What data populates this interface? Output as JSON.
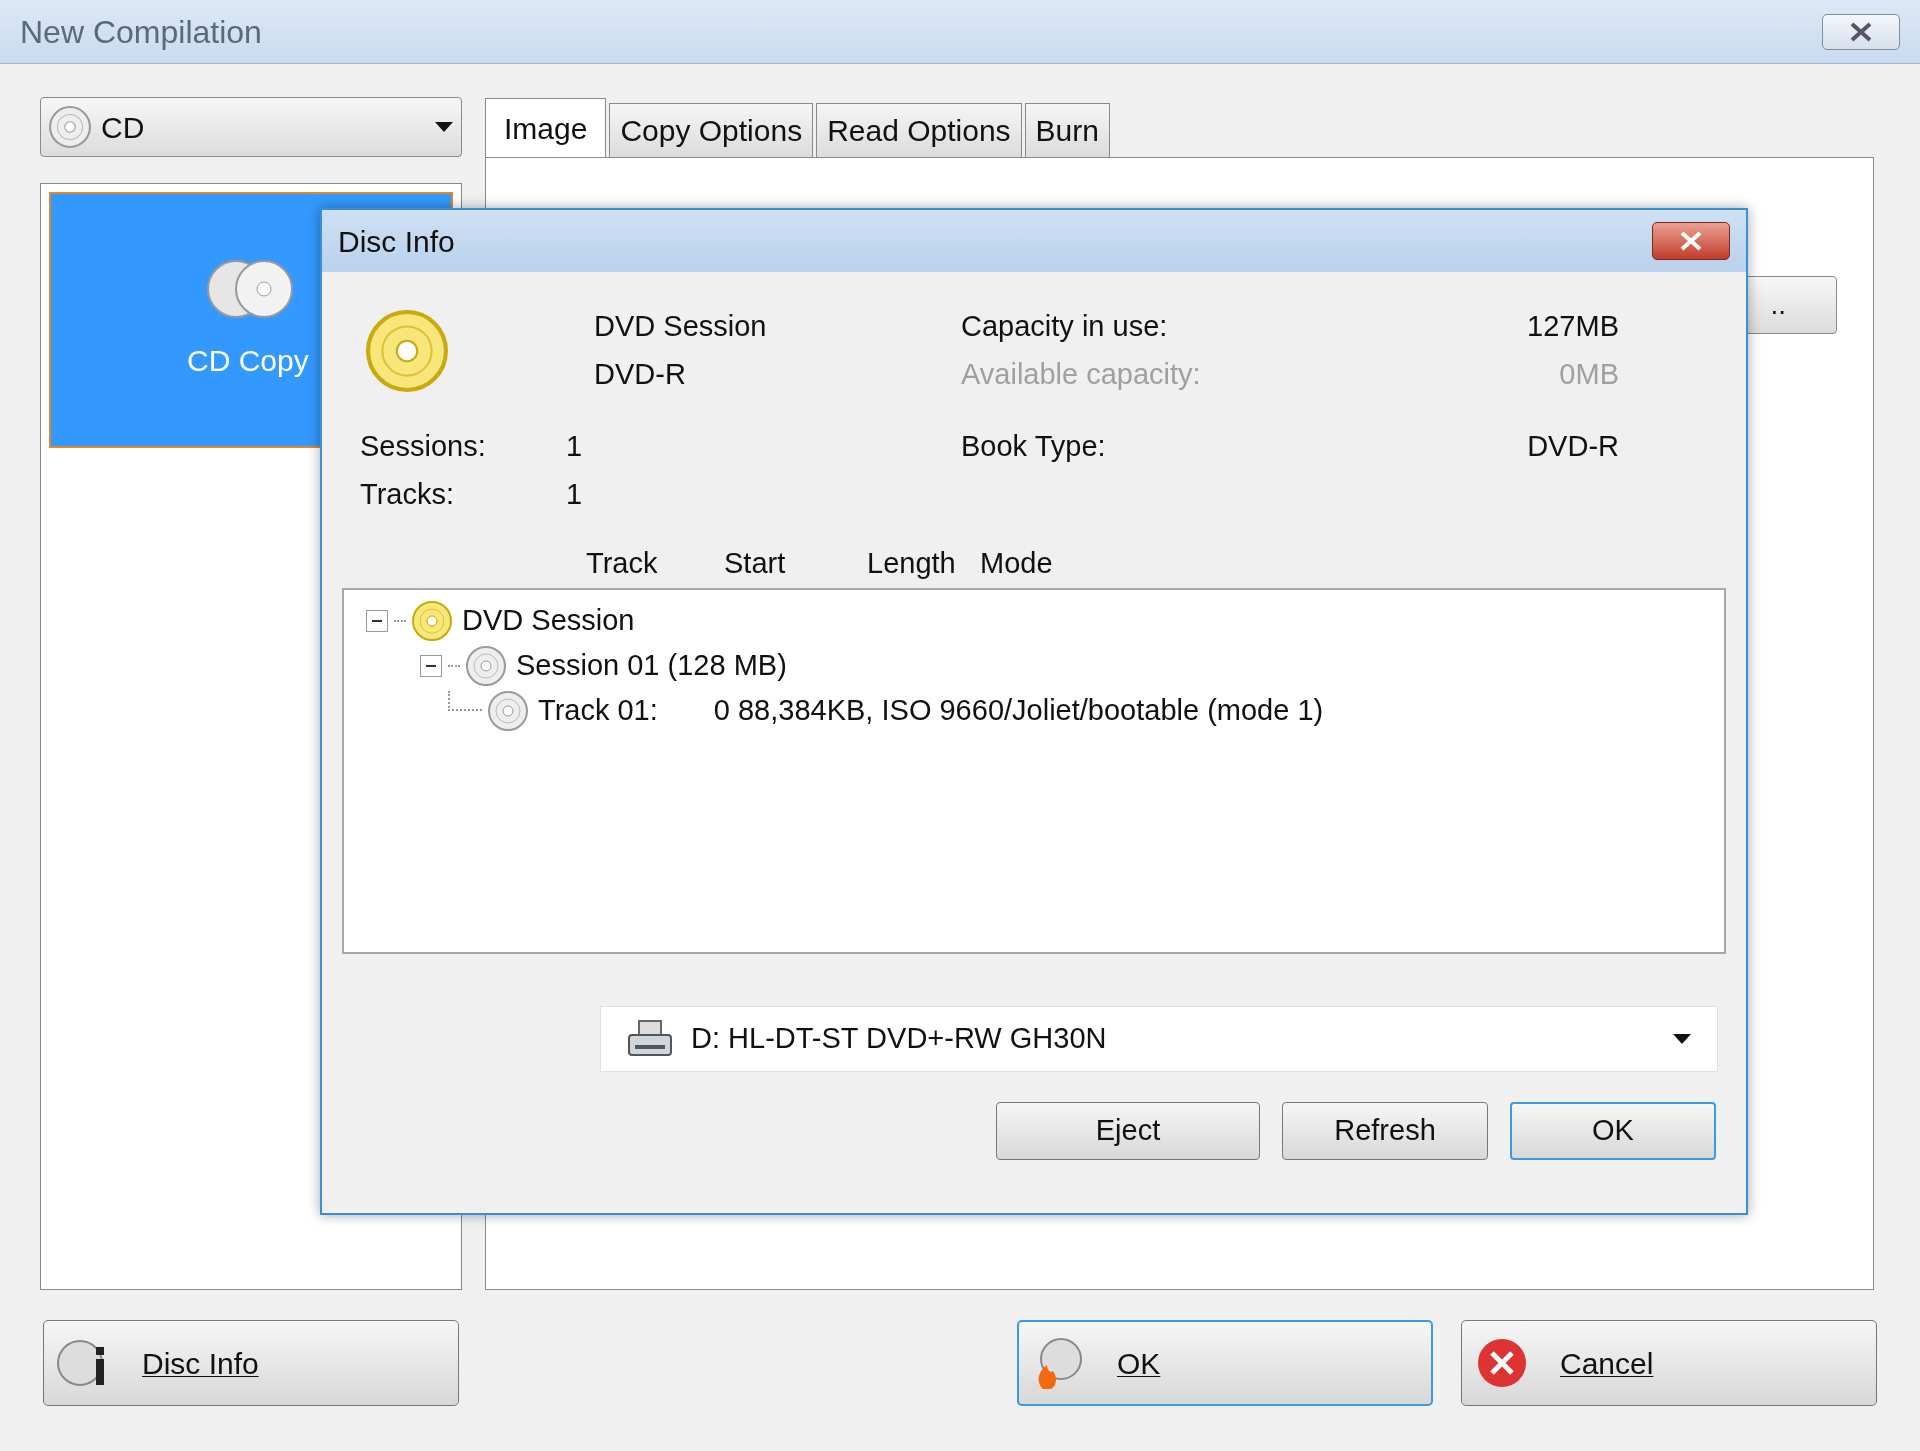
{
  "window": {
    "title": "New Compilation"
  },
  "drive_type": {
    "value": "CD"
  },
  "tabs": [
    {
      "label": "Image",
      "selected": true
    },
    {
      "label": "Copy Options",
      "selected": false
    },
    {
      "label": "Read Options",
      "selected": false
    },
    {
      "label": "Burn",
      "selected": false
    }
  ],
  "compilation_types": [
    {
      "label": "CD Copy",
      "selected": true
    }
  ],
  "panel": {
    "browse_button": ".."
  },
  "buttons": [
    {
      "label": "Disc Info",
      "kind": "info",
      "default": false
    },
    {
      "label": "OK",
      "kind": "burn",
      "default": true
    },
    {
      "label": "Cancel",
      "kind": "cancel",
      "default": false
    }
  ],
  "dialog": {
    "title": "Disc Info",
    "disc_name": "DVD Session",
    "disc_type": "DVD-R",
    "capacity": [
      {
        "label": "Capacity in use:",
        "value": "127MB",
        "disabled": false
      },
      {
        "label": "Available capacity:",
        "value": "0MB",
        "disabled": true
      }
    ],
    "counts": [
      {
        "label": "Sessions:",
        "value": "1"
      },
      {
        "label": "Tracks:",
        "value": "1"
      }
    ],
    "book_type": {
      "label": "Book Type:",
      "value": "DVD-R"
    },
    "columns": [
      "Track",
      "Start",
      "Length",
      "Mode"
    ],
    "tree": [
      {
        "kind": "dvd",
        "label": "DVD Session",
        "expanded": true,
        "children": [
          {
            "kind": "session",
            "label": "Session 01 (128 MB)",
            "expanded": true,
            "children": [
              {
                "kind": "track",
                "label": "Track 01:",
                "detail": "0 88,384KB, ISO 9660/Joliet/bootable (mode 1)"
              }
            ]
          }
        ]
      }
    ],
    "drive": "D: HL-DT-ST DVD+-RW GH30N",
    "buttons": [
      {
        "label": "Eject",
        "default": false
      },
      {
        "label": "Refresh",
        "default": false
      },
      {
        "label": "OK",
        "default": true
      }
    ]
  }
}
